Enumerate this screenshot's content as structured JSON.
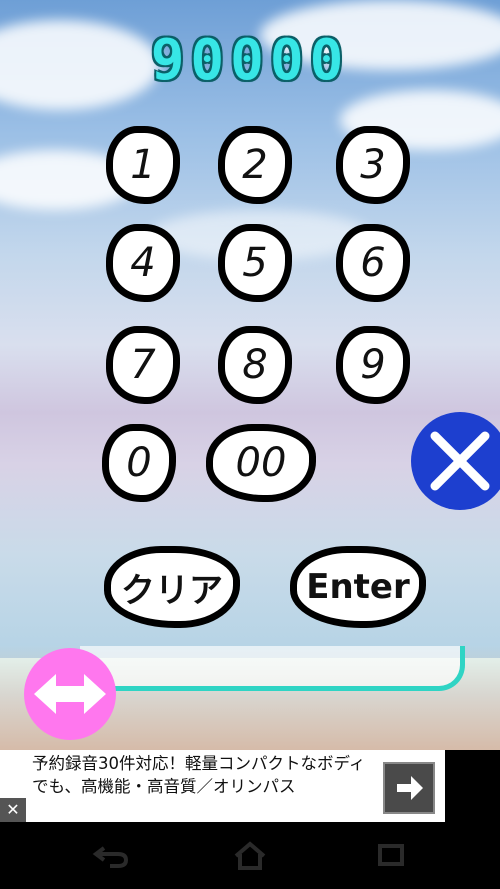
{
  "score": {
    "value": "90000"
  },
  "keypad": {
    "keys": [
      "1",
      "2",
      "3",
      "4",
      "5",
      "6",
      "7",
      "8",
      "9",
      "0",
      "00"
    ],
    "clear_label": "クリア",
    "enter_label": "Enter"
  },
  "ad": {
    "text": "予約録音30件対応！軽量コンパクトなボディでも、高機能・高音質／オリンパス",
    "close_glyph": "✕"
  },
  "icons": {
    "close": "close-x-icon",
    "swap": "left-right-arrow-icon",
    "ad_arrow": "right-arrow-icon",
    "nav": [
      "back-icon",
      "home-icon",
      "recent-apps-icon"
    ]
  },
  "colors": {
    "score": "#37e6e6",
    "close_button": "#1d3fcf",
    "swap_button": "#ff77ee",
    "track": "#2fd4c4"
  }
}
